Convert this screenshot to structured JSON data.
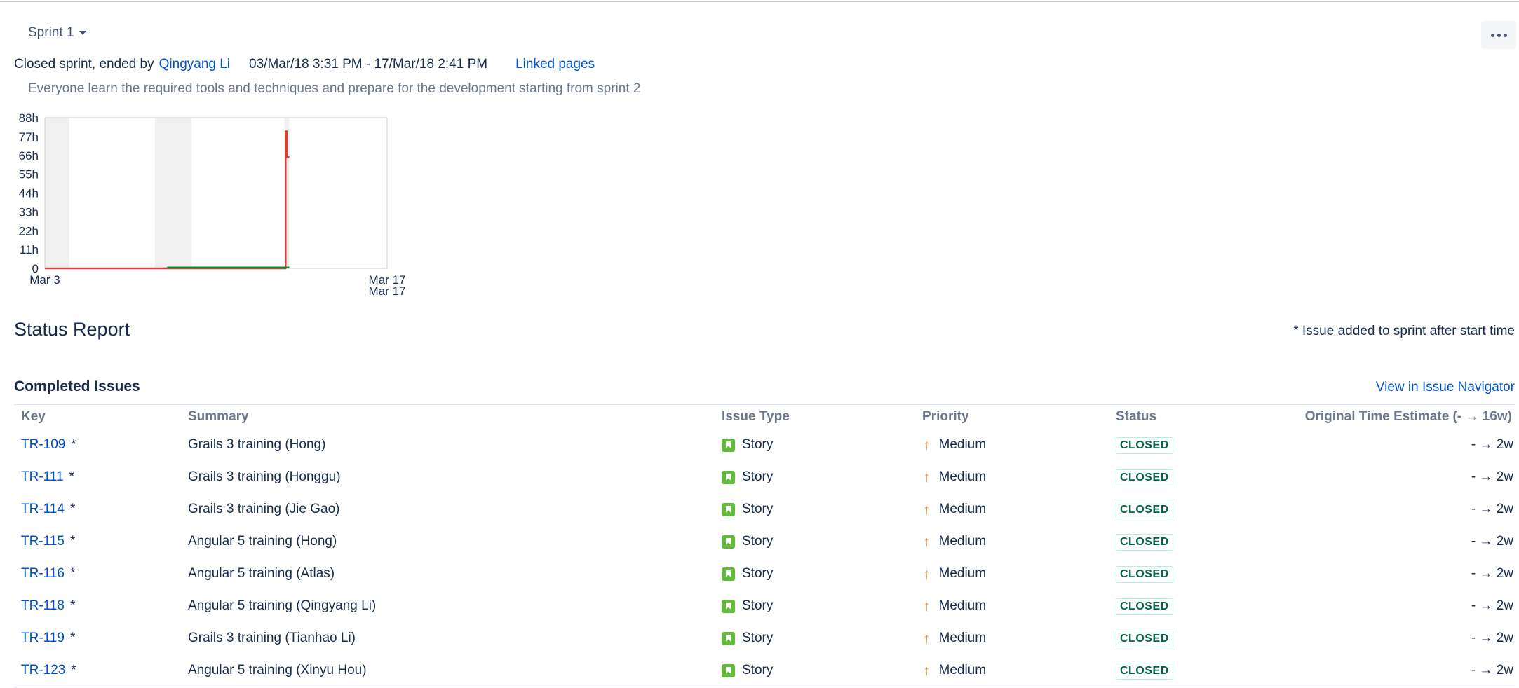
{
  "sprint": {
    "name": "Sprint 1",
    "state_prefix": "Closed sprint, ended by",
    "ended_by": "Qingyang Li",
    "dates": "03/Mar/18 3:31 PM - 17/Mar/18 2:41 PM",
    "linked_pages": "Linked pages",
    "goal": "Everyone learn the required tools and techniques and prepare for the development starting from sprint 2"
  },
  "chart_data": {
    "type": "line",
    "title": "",
    "xlabel": "",
    "ylabel": "",
    "y_ticks": [
      "88h",
      "77h",
      "66h",
      "55h",
      "44h",
      "33h",
      "22h",
      "11h",
      "0"
    ],
    "x_ticks": [
      "Mar 3",
      "Mar 17",
      "Mar 17"
    ],
    "ylim": [
      0,
      88
    ],
    "x_range_days": [
      0,
      14
    ],
    "non_working_bands_days": [
      [
        0,
        1
      ],
      [
        4.5,
        6
      ],
      [
        9.8,
        10
      ]
    ],
    "series": [
      {
        "color": "#d04437",
        "points": [
          [
            0,
            0
          ],
          [
            9.85,
            0
          ],
          [
            9.85,
            80
          ],
          [
            9.9,
            80
          ],
          [
            9.9,
            65
          ],
          [
            10,
            65
          ]
        ]
      },
      {
        "color": "#14892c",
        "points": [
          [
            5,
            0.5
          ],
          [
            10,
            0.5
          ]
        ]
      }
    ]
  },
  "status_report": {
    "title": "Status Report",
    "note": "* Issue added to sprint after start time"
  },
  "completed": {
    "title": "Completed Issues",
    "navigator_link": "View in Issue Navigator",
    "columns": {
      "key": "Key",
      "summary": "Summary",
      "type": "Issue Type",
      "priority": "Priority",
      "status": "Status",
      "estimate": "Original Time Estimate (- → 16w)"
    },
    "rows": [
      {
        "key": "TR-109",
        "summary": "Grails 3 training (Hong)",
        "type": "Story",
        "priority": "Medium",
        "status": "CLOSED",
        "estimate": "- → 2w"
      },
      {
        "key": "TR-111",
        "summary": "Grails 3 training (Honggu)",
        "type": "Story",
        "priority": "Medium",
        "status": "CLOSED",
        "estimate": "- → 2w"
      },
      {
        "key": "TR-114",
        "summary": "Grails 3 training (Jie Gao)",
        "type": "Story",
        "priority": "Medium",
        "status": "CLOSED",
        "estimate": "- → 2w"
      },
      {
        "key": "TR-115",
        "summary": "Angular 5 training (Hong)",
        "type": "Story",
        "priority": "Medium",
        "status": "CLOSED",
        "estimate": "- → 2w"
      },
      {
        "key": "TR-116",
        "summary": "Angular 5 training (Atlas)",
        "type": "Story",
        "priority": "Medium",
        "status": "CLOSED",
        "estimate": "- → 2w"
      },
      {
        "key": "TR-118",
        "summary": "Angular 5 training (Qingyang Li)",
        "type": "Story",
        "priority": "Medium",
        "status": "CLOSED",
        "estimate": "- → 2w"
      },
      {
        "key": "TR-119",
        "summary": "Grails 3 training (Tianhao Li)",
        "type": "Story",
        "priority": "Medium",
        "status": "CLOSED",
        "estimate": "- → 2w"
      },
      {
        "key": "TR-123",
        "summary": "Angular 5 training (Xinyu Hou)",
        "type": "Story",
        "priority": "Medium",
        "status": "CLOSED",
        "estimate": "- → 2w"
      }
    ],
    "added_marker": "*"
  },
  "colors": {
    "link": "#0052cc",
    "closed_text": "#006644",
    "closed_border": "#abf5d1",
    "story": "#63ba3c",
    "priority_medium": "#f79232"
  },
  "icons": {
    "priority": "arrow-up-icon",
    "type": "story-icon",
    "more": "ellipsis-icon"
  }
}
